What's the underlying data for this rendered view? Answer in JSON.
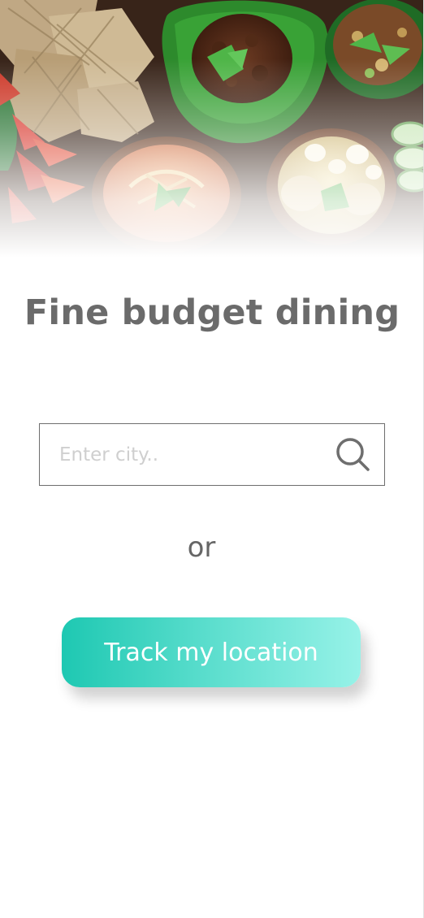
{
  "hero": {
    "icon": "food-dishes-illustration"
  },
  "title": "Fine budget dining",
  "search": {
    "placeholder": "Enter city..",
    "value": "",
    "icon": "search-icon"
  },
  "divider_text": "or",
  "track_button_label": "Track my location",
  "colors": {
    "title": "#6b6b6b",
    "accent_start": "#1ec8b2",
    "accent_end": "#97f2e8",
    "border": "#6e6e6e",
    "placeholder": "#cfcfcf"
  }
}
